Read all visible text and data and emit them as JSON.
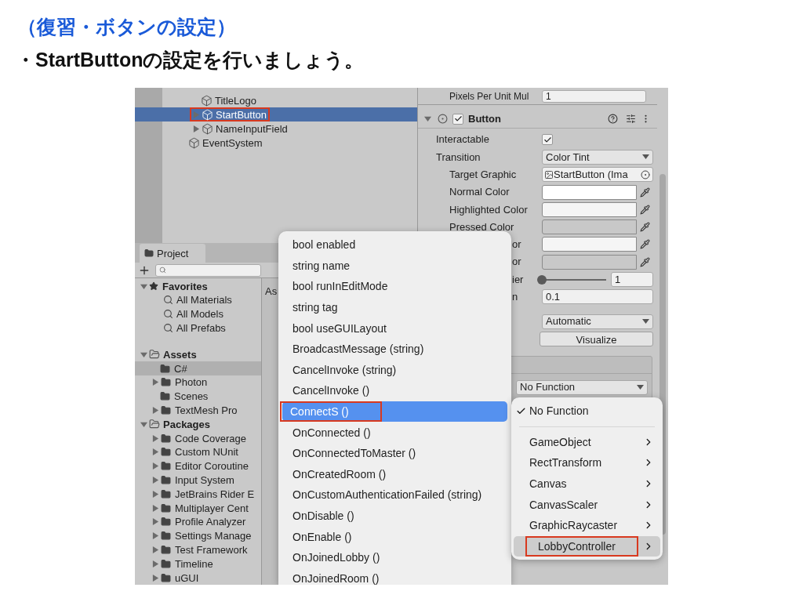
{
  "slide": {
    "heading": "（復習・ボタンの設定）",
    "bullet": "・StartButtonの設定を行いましょう。"
  },
  "hierarchy": {
    "items": [
      {
        "children": [
          {
            "label": "TitleLogo",
            "expandable": false,
            "selected": false,
            "annotated": false
          },
          {
            "label": "StartButton",
            "expandable": true,
            "selected": true,
            "annotated": true
          },
          {
            "label": "NameInputField",
            "expandable": true,
            "selected": false,
            "annotated": false
          }
        ]
      },
      {
        "label": "EventSystem",
        "expandable": false,
        "selected": false,
        "annotated": false
      }
    ]
  },
  "project": {
    "tab": "Project",
    "breadcrumb": "As",
    "tree": [
      {
        "label": "Favorites",
        "kind": "favorites",
        "expanded": true,
        "selected": false,
        "children": [
          {
            "label": "All Materials",
            "kind": "search",
            "selected": false
          },
          {
            "label": "All Models",
            "kind": "search",
            "selected": false
          },
          {
            "label": "All Prefabs",
            "kind": "search",
            "selected": false
          }
        ]
      },
      {
        "label": "Assets",
        "kind": "root",
        "expanded": true,
        "selected": false,
        "children": [
          {
            "label": "C#",
            "kind": "folder",
            "expandable": false,
            "selected": true
          },
          {
            "label": "Photon",
            "kind": "folder",
            "expandable": true,
            "selected": false
          },
          {
            "label": "Scenes",
            "kind": "folder",
            "expandable": false,
            "selected": false
          },
          {
            "label": "TextMesh Pro",
            "kind": "folder",
            "expandable": true,
            "selected": false
          }
        ]
      },
      {
        "label": "Packages",
        "kind": "root",
        "expanded": true,
        "selected": false,
        "children": [
          {
            "label": "Code Coverage",
            "kind": "folder",
            "expandable": true,
            "selected": false
          },
          {
            "label": "Custom NUnit",
            "kind": "folder",
            "expandable": true,
            "selected": false
          },
          {
            "label": "Editor Coroutine",
            "kind": "folder",
            "expandable": true,
            "selected": false
          },
          {
            "label": "Input System",
            "kind": "folder",
            "expandable": true,
            "selected": false
          },
          {
            "label": "JetBrains Rider E",
            "kind": "folder",
            "expandable": true,
            "selected": false
          },
          {
            "label": "Multiplayer Cent",
            "kind": "folder",
            "expandable": true,
            "selected": false
          },
          {
            "label": "Profile Analyzer",
            "kind": "folder",
            "expandable": true,
            "selected": false
          },
          {
            "label": "Settings Manage",
            "kind": "folder",
            "expandable": true,
            "selected": false
          },
          {
            "label": "Test Framework",
            "kind": "folder",
            "expandable": true,
            "selected": false
          },
          {
            "label": "Timeline",
            "kind": "folder",
            "expandable": true,
            "selected": false
          },
          {
            "label": "uGUI",
            "kind": "folder",
            "expandable": true,
            "selected": false
          }
        ]
      }
    ]
  },
  "inspector": {
    "top_row": {
      "label": "Pixels Per Unit Mul",
      "value": "1"
    },
    "component": {
      "title": "Button",
      "expanded": true,
      "enabled": true
    },
    "rows": [
      {
        "kind": "checkbox",
        "label": "Interactable",
        "checked": true
      },
      {
        "kind": "dropdown",
        "label": "Transition",
        "value": "Color Tint",
        "children": [
          {
            "kind": "object",
            "label": "Target Graphic",
            "value": "StartButton (Ima"
          },
          {
            "kind": "color",
            "label": "Normal Color",
            "color": "#ffffff"
          },
          {
            "kind": "color",
            "label": "Highlighted Color",
            "color": "#f5f5f5"
          },
          {
            "kind": "color",
            "label": "Pressed Color",
            "color": "#c8c8c8"
          },
          {
            "kind": "color",
            "label": "or",
            "cut": true,
            "color": "#f5f5f5"
          },
          {
            "kind": "color",
            "label": "or",
            "cut": true,
            "color": "#c8c8c8"
          },
          {
            "kind": "slider",
            "label": "ier",
            "cut": true,
            "level": 0,
            "value": "1"
          },
          {
            "kind": "number",
            "label": "n",
            "cut": true,
            "value": "0.1"
          }
        ]
      },
      {
        "kind": "dropdown",
        "value": "Automatic"
      },
      {
        "kind": "button",
        "value": "Visualize"
      }
    ],
    "event_function": "No Function"
  },
  "method_menu": {
    "items": [
      {
        "label": "bool enabled",
        "selected": false,
        "annotated": false
      },
      {
        "label": "string name",
        "selected": false,
        "annotated": false
      },
      {
        "label": "bool runInEditMode",
        "selected": false,
        "annotated": false
      },
      {
        "label": "string tag",
        "selected": false,
        "annotated": false
      },
      {
        "label": "bool useGUILayout",
        "selected": false,
        "annotated": false
      },
      {
        "label": "BroadcastMessage (string)",
        "selected": false,
        "annotated": false
      },
      {
        "label": "CancelInvoke (string)",
        "selected": false,
        "annotated": false
      },
      {
        "label": "CancelInvoke ()",
        "selected": false,
        "annotated": false
      },
      {
        "label": "ConnectS ()",
        "selected": true,
        "annotated": true
      },
      {
        "label": "OnConnected ()",
        "selected": false,
        "annotated": false
      },
      {
        "label": "OnConnectedToMaster ()",
        "selected": false,
        "annotated": false
      },
      {
        "label": "OnCreatedRoom ()",
        "selected": false,
        "annotated": false
      },
      {
        "label": "OnCustomAuthenticationFailed (string)",
        "selected": false,
        "annotated": false
      },
      {
        "label": "OnDisable ()",
        "selected": false,
        "annotated": false
      },
      {
        "label": "OnEnable ()",
        "selected": false,
        "annotated": false
      },
      {
        "label": "OnJoinedLobby ()",
        "selected": false,
        "annotated": false
      },
      {
        "label": "OnJoinedRoom ()",
        "selected": false,
        "annotated": false
      }
    ]
  },
  "function_menu": {
    "items": [
      {
        "label": "No Function",
        "checked": true,
        "submenu": false,
        "selected": false,
        "annotated": false
      },
      {
        "label": "GameObject",
        "checked": false,
        "submenu": true,
        "selected": false,
        "annotated": false
      },
      {
        "label": "RectTransform",
        "checked": false,
        "submenu": true,
        "selected": false,
        "annotated": false
      },
      {
        "label": "Canvas",
        "checked": false,
        "submenu": true,
        "selected": false,
        "annotated": false
      },
      {
        "label": "CanvasScaler",
        "checked": false,
        "submenu": true,
        "selected": false,
        "annotated": false
      },
      {
        "label": "GraphicRaycaster",
        "checked": false,
        "submenu": true,
        "selected": false,
        "annotated": false
      },
      {
        "label": "LobbyController",
        "checked": false,
        "submenu": true,
        "selected": true,
        "annotated": true
      }
    ]
  }
}
